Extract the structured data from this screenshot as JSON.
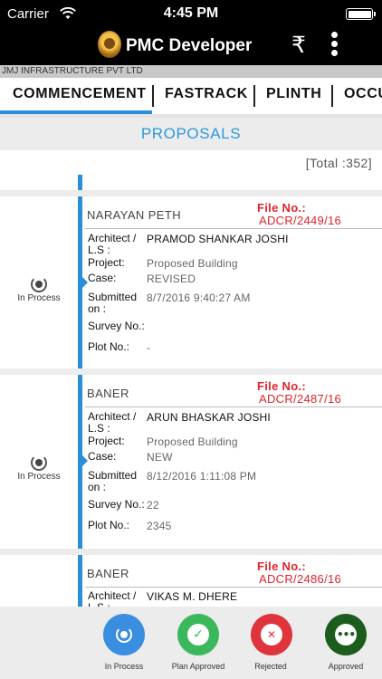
{
  "status_bar": {
    "carrier": "Carrier",
    "time": "4:45 PM"
  },
  "app": {
    "title": "PMC Developer",
    "rupee_symbol": "₹"
  },
  "company": "JMJ INFRASTRUCTURE PVT LTD",
  "tabs": [
    {
      "label": "COMMENCEMENT",
      "active": true
    },
    {
      "label": "FASTRACK"
    },
    {
      "label": "PLINTH"
    },
    {
      "label": "OCCU"
    }
  ],
  "section_title": "PROPOSALS",
  "total": "[Total :352]",
  "field_labels": {
    "architect": "Architect / L.S :",
    "project": "Project:",
    "case": "Case:",
    "submitted": "Submitted on :",
    "survey": "Survey No.:",
    "plot": "Plot No.:",
    "file": "File No.:"
  },
  "proposals": [
    {
      "location": "NARAYAN PETH",
      "file_no": "ADCR/2449/16",
      "architect": "PRAMOD SHANKAR JOSHI",
      "project": "Proposed Building",
      "case": "REVISED",
      "submitted": "8/7/2016 9:40:27 AM",
      "survey": "",
      "plot": "-",
      "status": "In Process"
    },
    {
      "location": "BANER",
      "file_no": "ADCR/2487/16",
      "architect": "ARUN BHASKAR JOSHI",
      "project": "Proposed Building",
      "case": "NEW",
      "submitted": "8/12/2016 1:11:08 PM",
      "survey": "22",
      "plot": "2345",
      "status": "In Process"
    },
    {
      "location": "BANER",
      "file_no": "ADCR/2486/16",
      "architect": "VIKAS M. DHERE"
    }
  ],
  "bottom_actions": [
    {
      "label": "In Process",
      "color": "#3a8ee0",
      "icon": "in-process-icon"
    },
    {
      "label": "Plan Approved",
      "color": "#3cb85c",
      "icon": "check-icon"
    },
    {
      "label": "Rejected",
      "color": "#e0343c",
      "icon": "close-icon"
    },
    {
      "label": "Approved",
      "color": "#1c5c1c",
      "icon": "more-icon"
    }
  ]
}
